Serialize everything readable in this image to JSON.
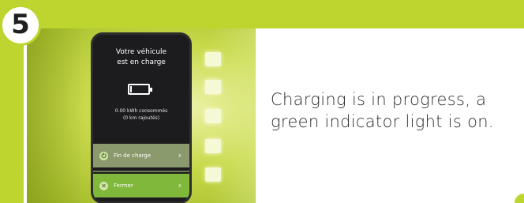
{
  "step": {
    "number": "5"
  },
  "screen": {
    "title_line1": "Votre véhicule",
    "title_line2": "est en charge",
    "energy_line1": "0.00 kWh consommés",
    "energy_line2": "(0 km rajoutés)",
    "battery_level": 0.1,
    "actions": [
      {
        "label": "Fin de charge",
        "icon": "power-icon"
      },
      {
        "label": "Fermer",
        "icon": "close-icon"
      }
    ]
  },
  "indicator_lights": {
    "count": 5,
    "active_color": "#f6f9d6"
  },
  "caption": "Charging is in progress, a green indicator light is on.",
  "colors": {
    "brand_green": "#bfd52f",
    "card": "#ffffff",
    "text": "#2f2f2f"
  }
}
